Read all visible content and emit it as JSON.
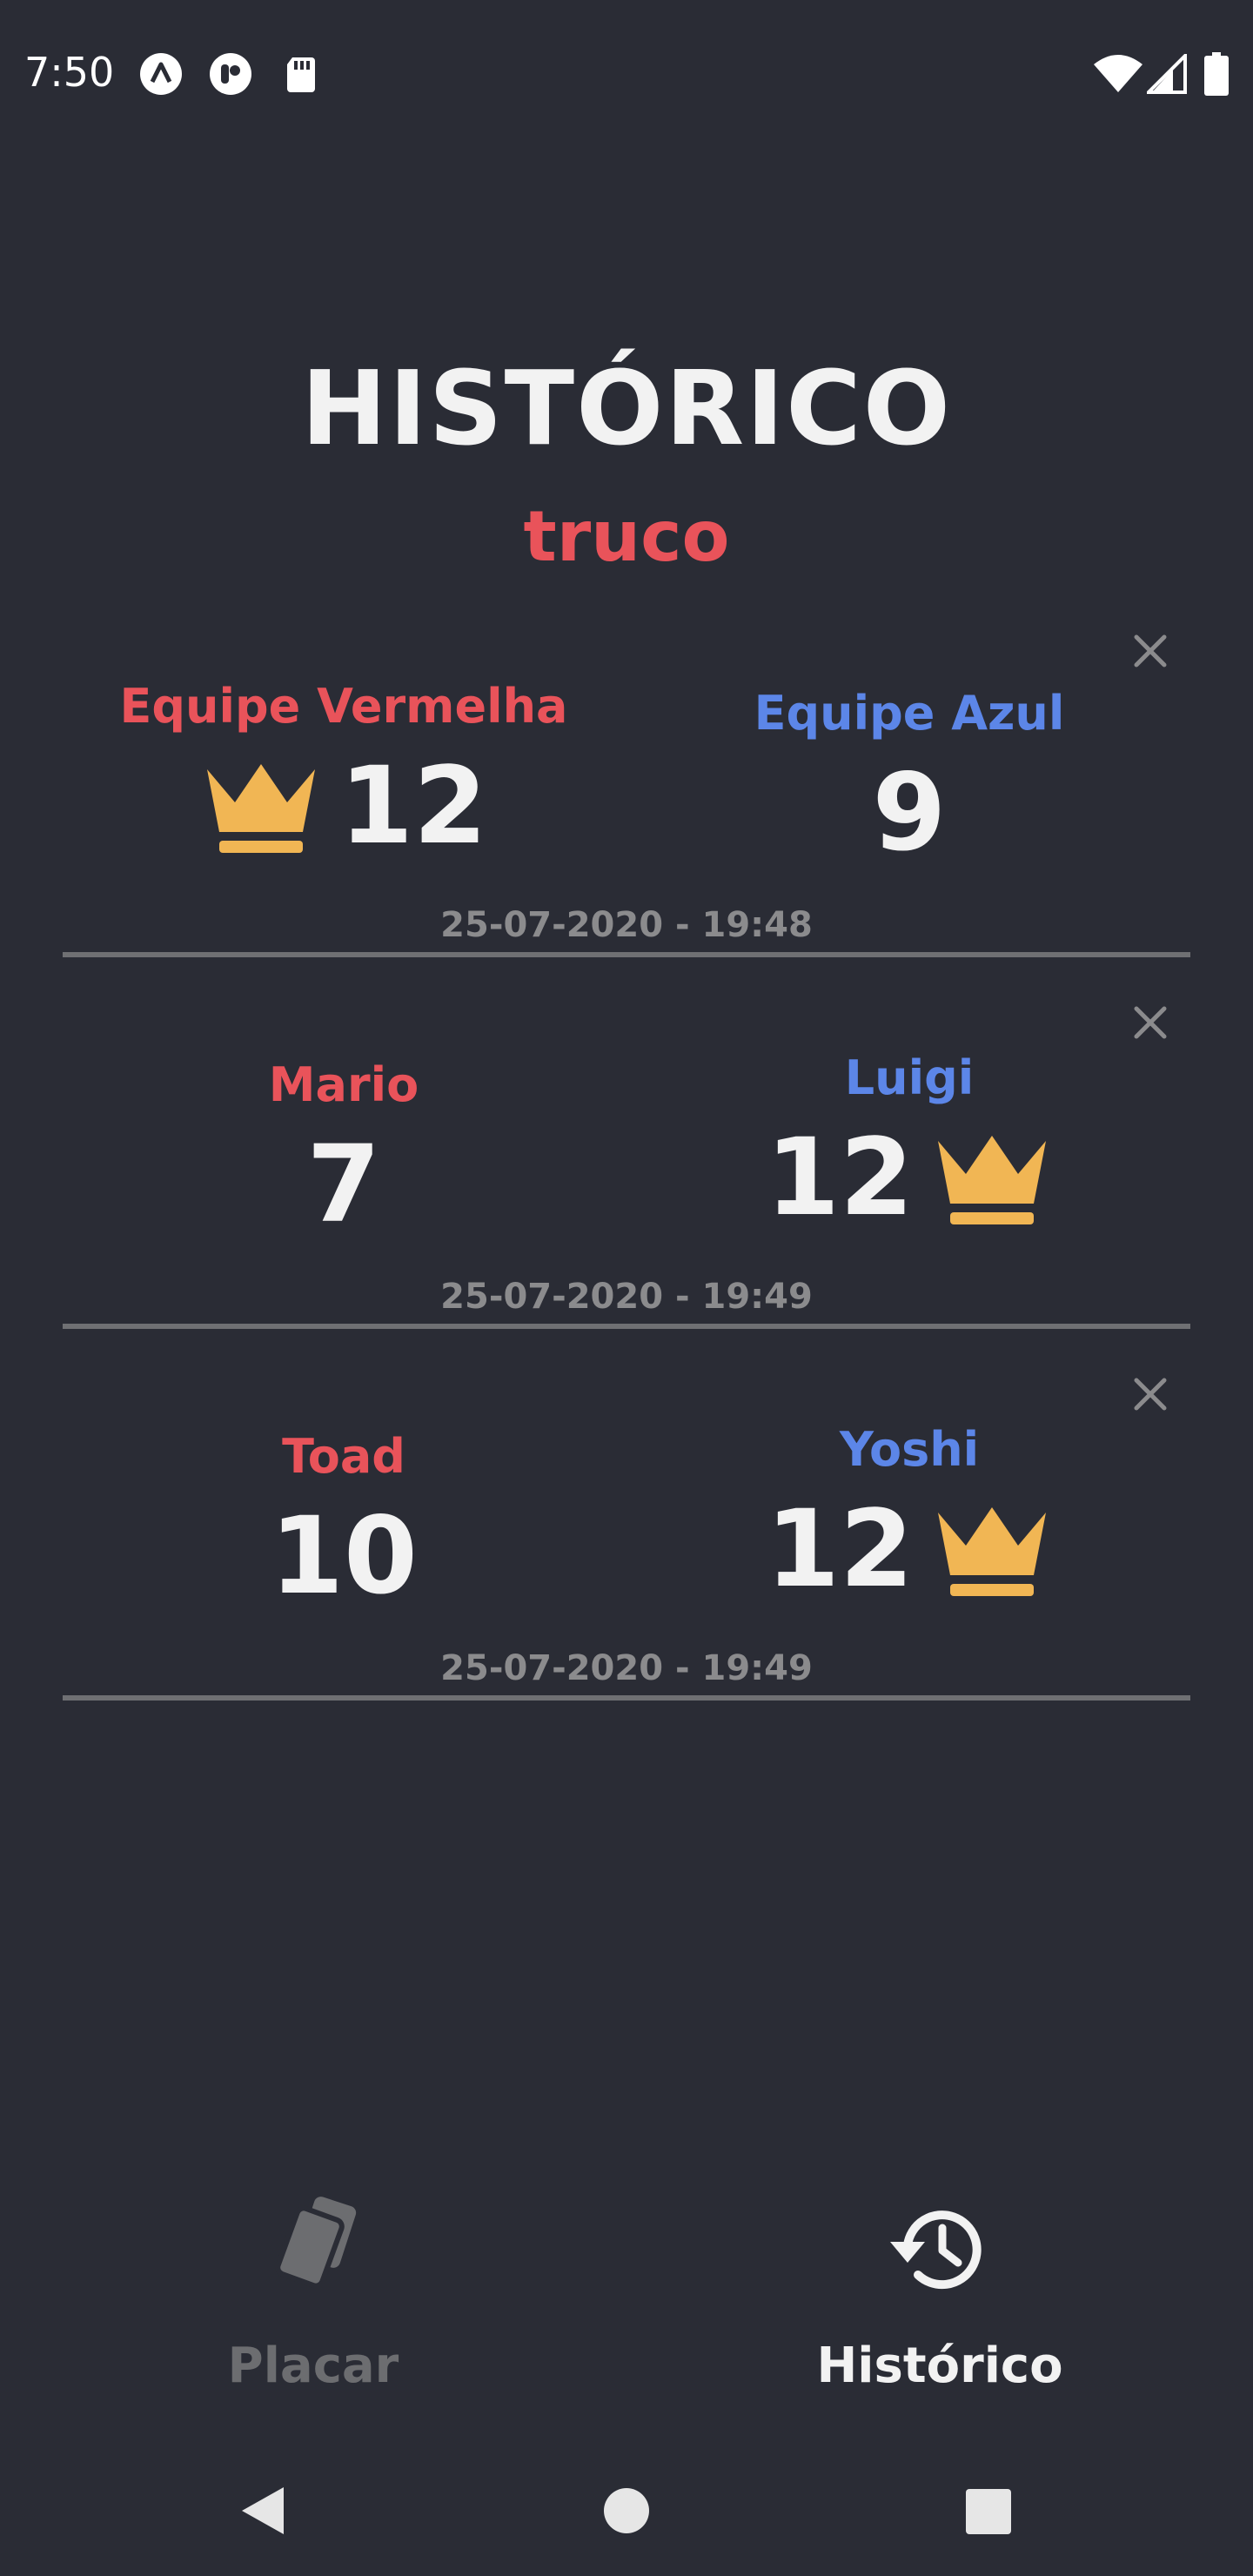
{
  "status_bar": {
    "time": "7:50",
    "notification_icons": [
      "app-a-icon",
      "app-b-icon",
      "sd-card-icon"
    ],
    "system_icons": [
      "wifi-icon",
      "signal-icon",
      "battery-icon"
    ]
  },
  "page": {
    "title": "HISTÓRICO",
    "subtitle": "truco"
  },
  "history": [
    {
      "left_team": "Equipe Vermelha",
      "left_score": "12",
      "right_team": "Equipe Azul",
      "right_score": "9",
      "winner": "left",
      "date": "25-07-2020 - 19:48"
    },
    {
      "left_team": "Mario",
      "left_score": "7",
      "right_team": "Luigi",
      "right_score": "12",
      "winner": "right",
      "date": "25-07-2020 - 19:49"
    },
    {
      "left_team": "Toad",
      "left_score": "10",
      "right_team": "Yoshi",
      "right_score": "12",
      "winner": "right",
      "date": "25-07-2020 - 19:49"
    }
  ],
  "bottom_nav": {
    "placar_label": "Placar",
    "historico_label": "Histórico",
    "active": "historico"
  },
  "colors": {
    "background": "#2a2c35",
    "red_team": "#e9535a",
    "blue_team": "#5c86e8",
    "crown": "#f1b654",
    "muted": "#8b8b8d"
  }
}
